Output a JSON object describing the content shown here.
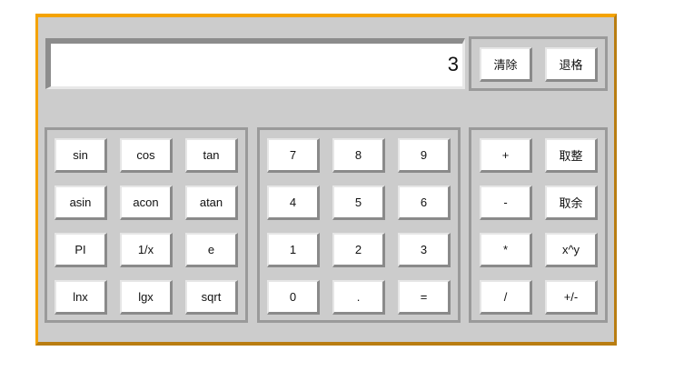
{
  "display": {
    "value": "3"
  },
  "controls": {
    "clear_label": "清除",
    "backspace_label": "退格"
  },
  "functions": {
    "sin": "sin",
    "cos": "cos",
    "tan": "tan",
    "asin": "asin",
    "acon": "acon",
    "atan": "atan",
    "pi": "PI",
    "reciprocal": "1/x",
    "e": "e",
    "ln": "lnx",
    "lg": "lgx",
    "sqrt": "sqrt"
  },
  "digits": {
    "seven": "7",
    "eight": "8",
    "nine": "9",
    "four": "4",
    "five": "5",
    "six": "6",
    "one": "1",
    "two": "2",
    "three": "3",
    "zero": "0",
    "dot": ".",
    "equals": "="
  },
  "operators": {
    "plus": "+",
    "round": "取整",
    "minus": "-",
    "mod": "取余",
    "multiply": "*",
    "power": "x^y",
    "divide": "/",
    "negate": "+/-"
  },
  "colors": {
    "frame_light": "#f4a300",
    "frame_dark": "#b97d12",
    "panel": "#cccccc"
  }
}
